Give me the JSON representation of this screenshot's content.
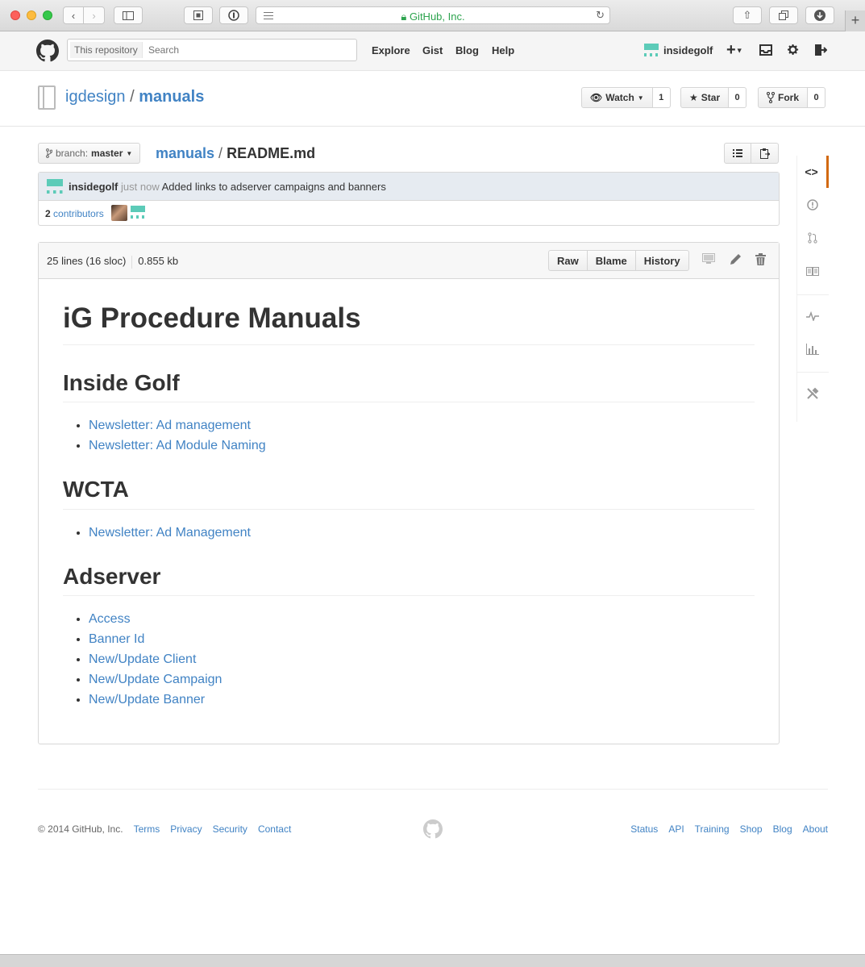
{
  "browser": {
    "address_text": "GitHub, Inc.",
    "lock_icon": "lock-icon",
    "new_tab_label": "+"
  },
  "header": {
    "search_scope": "This repository",
    "search_placeholder": "Search",
    "nav": [
      "Explore",
      "Gist",
      "Blog",
      "Help"
    ],
    "username": "insidegolf",
    "plus_label": "+",
    "accent": "#4183c4"
  },
  "repo": {
    "owner": "igdesign",
    "separator": "/",
    "name": "manuals",
    "watch_label": "Watch",
    "watch_count": "1",
    "star_label": "Star",
    "star_count": "0",
    "fork_label": "Fork",
    "fork_count": "0"
  },
  "file_nav": {
    "branch_prefix": "branch:",
    "branch_name": "master",
    "crumb_repo": "manuals",
    "crumb_sep": "/",
    "crumb_file": "README.md"
  },
  "commit": {
    "author": "insidegolf",
    "time": "just now",
    "message": "Added links to adserver campaigns and banners",
    "contributors_count": "2",
    "contributors_label": "contributors"
  },
  "file": {
    "lines": "25 lines (16 sloc)",
    "size": "0.855 kb",
    "raw_label": "Raw",
    "blame_label": "Blame",
    "history_label": "History"
  },
  "readme": {
    "title": "iG Procedure Manuals",
    "sections": [
      {
        "heading": "Inside Golf",
        "links": [
          "Newsletter: Ad management",
          "Newsletter: Ad Module Naming"
        ]
      },
      {
        "heading": "WCTA",
        "links": [
          "Newsletter: Ad Management"
        ]
      },
      {
        "heading": "Adserver",
        "links": [
          "Access",
          "Banner Id",
          "New/Update Client",
          "New/Update Campaign",
          "New/Update Banner"
        ]
      }
    ]
  },
  "footer": {
    "copyright": "© 2014 GitHub, Inc.",
    "left_links": [
      "Terms",
      "Privacy",
      "Security",
      "Contact"
    ],
    "right_links": [
      "Status",
      "API",
      "Training",
      "Shop",
      "Blog",
      "About"
    ]
  }
}
